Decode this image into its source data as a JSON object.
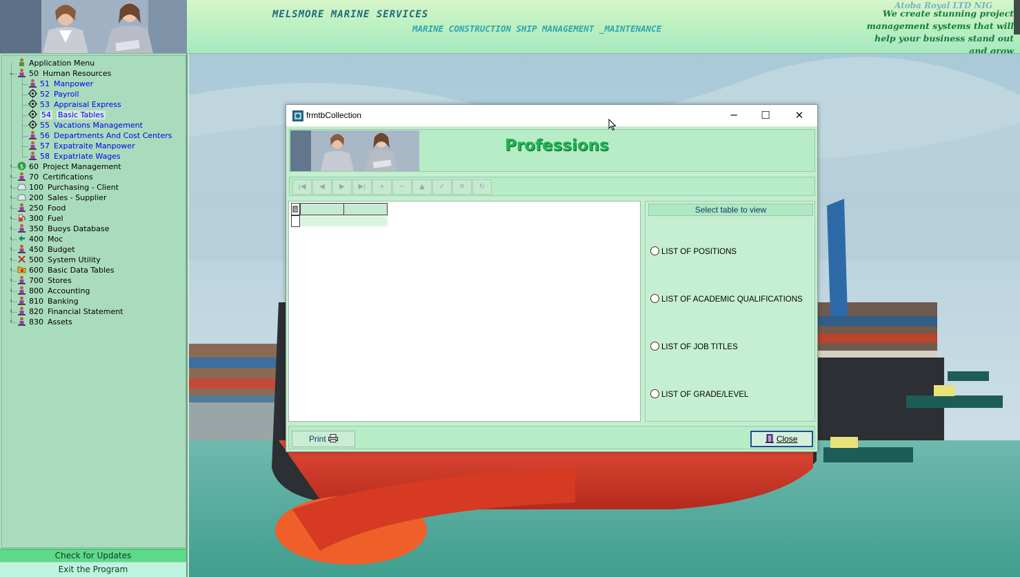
{
  "header": {
    "company_name": "MELSMORE MARINE SERVICES",
    "tagline": "MARINE CONSTRUCTION SHIP MANAGEMENT _MAINTENANCE",
    "brand_name": "Atoba Royal LTD NIG",
    "slogan": "We create stunning project management systems that will help your business stand out and grow"
  },
  "sidebar": {
    "root": "Application Menu",
    "items": [
      {
        "code": "50",
        "label": "Human Resources",
        "expanded": true,
        "icon": "person-icon"
      },
      {
        "code": "51",
        "label": "Manpower",
        "child": true,
        "icon": "person-icon"
      },
      {
        "code": "52",
        "label": "Payroll",
        "child": true,
        "icon": "gear-icon"
      },
      {
        "code": "53",
        "label": "Appraisal Express",
        "child": true,
        "icon": "gear-icon"
      },
      {
        "code": "54",
        "label": "Basic Tables",
        "child": true,
        "selected": true,
        "icon": "gear-icon"
      },
      {
        "code": "55",
        "label": "Vacations Management",
        "child": true,
        "icon": "gear-icon"
      },
      {
        "code": "56",
        "label": "Departments And Cost Centers",
        "child": true,
        "icon": "person-icon"
      },
      {
        "code": "57",
        "label": "Expatraite Manpower",
        "child": true,
        "icon": "person-icon"
      },
      {
        "code": "58",
        "label": "Expatriate Wages",
        "child": true,
        "icon": "person-icon"
      },
      {
        "code": "60",
        "label": "Project Management",
        "icon": "dollar-icon"
      },
      {
        "code": "70",
        "label": "Certifications",
        "icon": "person-icon"
      },
      {
        "code": "100",
        "label": "Purchasing  - Client",
        "icon": "tray-icon"
      },
      {
        "code": "200",
        "label": "Sales - Supplier",
        "icon": "tray-icon"
      },
      {
        "code": "250",
        "label": "Food",
        "icon": "person-icon"
      },
      {
        "code": "300",
        "label": "Fuel",
        "icon": "pump-icon"
      },
      {
        "code": "350",
        "label": "Buoys Database",
        "icon": "person-icon"
      },
      {
        "code": "400",
        "label": "Moc",
        "icon": "arrow-icon"
      },
      {
        "code": "450",
        "label": "Budget",
        "icon": "person-icon"
      },
      {
        "code": "500",
        "label": "System Utility",
        "icon": "tools-icon"
      },
      {
        "code": "600",
        "label": "Basic  Data Tables",
        "icon": "folder-icon"
      },
      {
        "code": "700",
        "label": "Stores",
        "icon": "person-icon"
      },
      {
        "code": "800",
        "label": "Accounting",
        "icon": "person-icon"
      },
      {
        "code": "810",
        "label": "Banking",
        "icon": "person-icon"
      },
      {
        "code": "820",
        "label": "Financial Statement",
        "icon": "person-icon"
      },
      {
        "code": "830",
        "label": "Assets",
        "icon": "person-icon"
      }
    ],
    "check_updates": "Check for Updates",
    "exit": "Exit the Program"
  },
  "dialog": {
    "title": "frmtbCollection",
    "heading": "Professions",
    "select_label": "Select table to view",
    "options": [
      "LIST OF POSITIONS",
      "LIST OF ACADEMIC QUALIFICATIONS",
      "LIST OF JOB TITLES",
      "LIST OF GRADE/LEVEL"
    ],
    "print_label": "Print",
    "close_label": "Close",
    "nav_buttons": [
      {
        "name": "first-record-button",
        "glyph": "|◀"
      },
      {
        "name": "prior-record-button",
        "glyph": "◀"
      },
      {
        "name": "next-record-button",
        "glyph": "▶"
      },
      {
        "name": "last-record-button",
        "glyph": "▶|"
      },
      {
        "name": "insert-record-button",
        "glyph": "+"
      },
      {
        "name": "delete-record-button",
        "glyph": "−"
      },
      {
        "name": "edit-record-button",
        "glyph": "▲"
      },
      {
        "name": "post-record-button",
        "glyph": "✓"
      },
      {
        "name": "cancel-record-button",
        "glyph": "✕"
      },
      {
        "name": "refresh-record-button",
        "glyph": "↻"
      }
    ]
  },
  "colors": {
    "accent": "#22b455",
    "panel": "#c3efcf",
    "sidebar": "#a9dcbc",
    "link": "#0000ee"
  }
}
